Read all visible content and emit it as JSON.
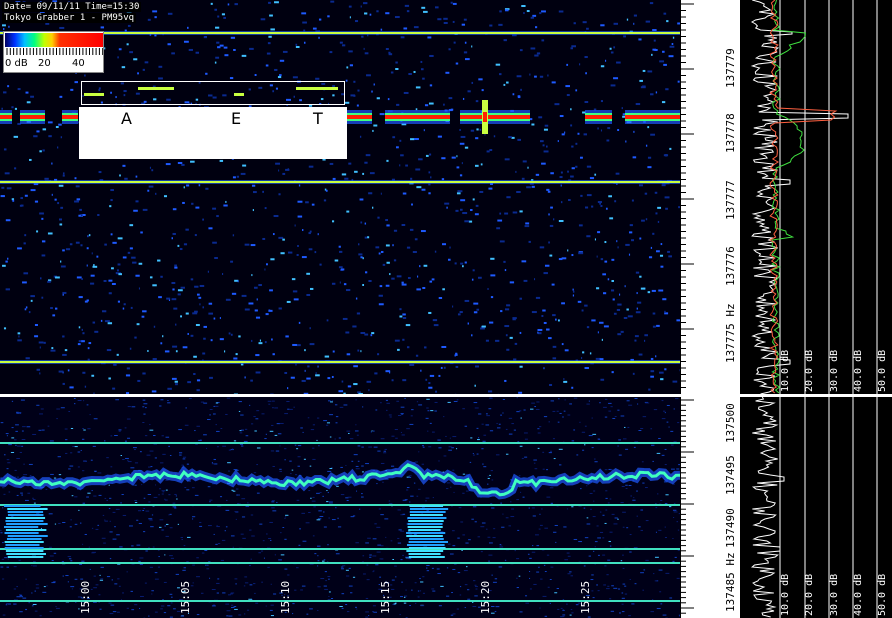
{
  "info": {
    "date_line": "Date= 09/11/11  Time=15:30",
    "station_line": "Tokyo Grabber 1 - PM95vq"
  },
  "legend": {
    "labels": [
      "0 dB",
      "20",
      "40"
    ]
  },
  "morse": {
    "letters": [
      "A",
      "E",
      "T"
    ]
  },
  "top_panel": {
    "freq_labels": [
      "137779",
      "137778",
      "137777",
      "137776",
      "137775 Hz"
    ],
    "db_labels": [
      "10.0 dB",
      "20.0 dB",
      "30.0 dB",
      "40.0 dB",
      "50.0 dB"
    ]
  },
  "bottom_panel": {
    "freq_labels": [
      "137500",
      "137495",
      "137490",
      "137485 Hz"
    ],
    "time_labels": [
      "15:00",
      "15:05",
      "15:10",
      "15:15",
      "15:20",
      "15:25"
    ],
    "db_labels": [
      "10.0 dB",
      "20.0 dB",
      "30.0 dB",
      "40.0 dB",
      "50.0 dB"
    ]
  },
  "colors": {
    "carrier": "#c8ff40",
    "signal_core": "#ff2000",
    "noise": "#1e5aff",
    "spectrum_trace": "#ffffff",
    "spectrum_green": "#40e040",
    "spectrum_red": "#ff6040"
  }
}
